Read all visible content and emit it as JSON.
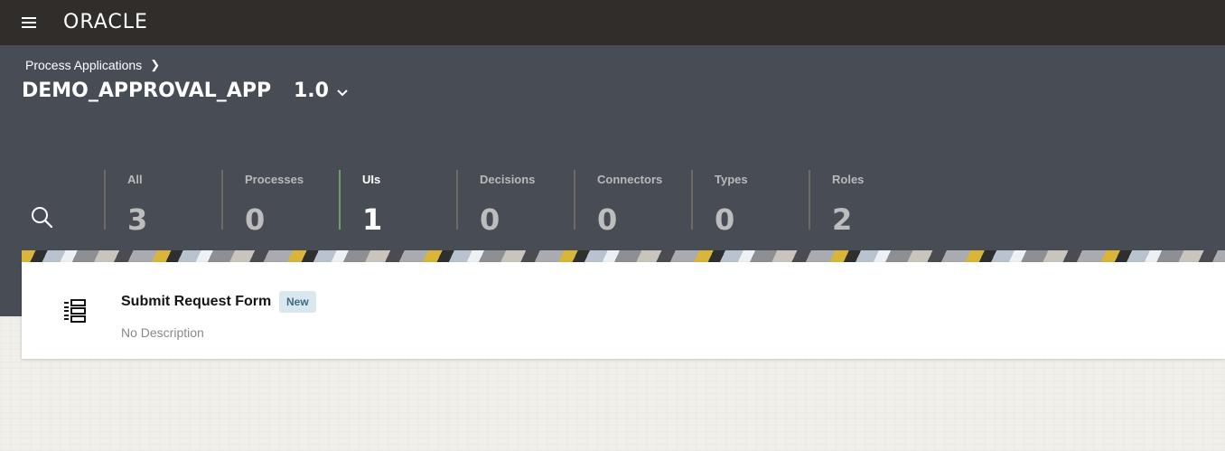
{
  "topbar": {
    "menu_icon": "hamburger-icon",
    "logo_text": "ORACLE",
    "background": "#312d2a"
  },
  "header": {
    "breadcrumb": "Process Applications",
    "app_name": "DEMO_APPROVAL_APP",
    "version": "1.0",
    "background": "#474c55"
  },
  "filters": {
    "search_icon": "search-icon",
    "tabs": [
      {
        "label": "All",
        "count": "3",
        "active": false
      },
      {
        "label": "Processes",
        "count": "0",
        "active": false
      },
      {
        "label": "UIs",
        "count": "1",
        "active": true
      },
      {
        "label": "Decisions",
        "count": "0",
        "active": false
      },
      {
        "label": "Connectors",
        "count": "0",
        "active": false
      },
      {
        "label": "Types",
        "count": "0",
        "active": false
      },
      {
        "label": "Roles",
        "count": "2",
        "active": false
      }
    ],
    "active_accent": "#6f9d6c"
  },
  "items": [
    {
      "icon": "form-list-icon",
      "title": "Submit Request Form",
      "badge": "New",
      "description": "No Description"
    }
  ]
}
